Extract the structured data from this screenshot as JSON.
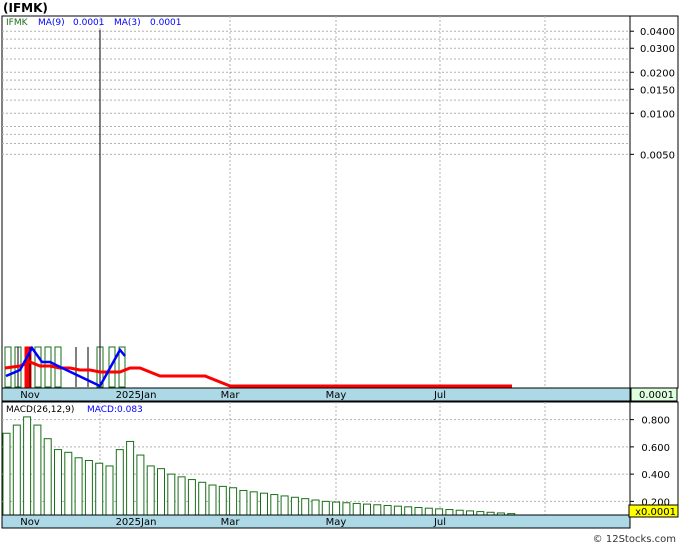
{
  "title": "(IFMK)",
  "footer": "© 12Stocks.com",
  "colors": {
    "frame": "#000000",
    "axis_band": "#add8e6",
    "grid": "#b0b0b0",
    "price_bar": "#1a6e1a",
    "ma9": "#ff0000",
    "ma3": "#0000ff",
    "macd_bar": "#1a6e1a",
    "last_value_bg": "#ddffdd",
    "macd_value_bg": "#ffff00",
    "legend_symbol": "#1a6e1a",
    "legend_ma": "#0000ff"
  },
  "chart_data": [
    {
      "type": "bar",
      "name": "price",
      "legend": {
        "symbol": "IFMK",
        "ma9_label": "MA(9)",
        "ma9_value": "0.0001",
        "ma3_label": "MA(3)",
        "ma3_value": "0.0001"
      },
      "x_ticks": [
        "Nov",
        "2025Jan",
        "Mar",
        "May",
        "Jul"
      ],
      "y_scale": "log",
      "y_ticks": [
        "0.0400",
        "0.0300",
        "0.0200",
        "0.0150",
        "0.0100",
        "0.0050"
      ],
      "last_value": "0.0001",
      "highlighted_bar_index": 2,
      "spike_bar_index": 6,
      "bars": [
        1,
        1,
        1,
        1,
        1,
        1,
        1,
        1,
        1,
        1,
        1,
        1
      ],
      "ma9": [
        0.75,
        0.75,
        0.75,
        0.6,
        0.6,
        0.6,
        0.6,
        0.6,
        1,
        1,
        0.6,
        0.6
      ],
      "ma3": [
        0.6,
        0.6,
        0.75,
        0.75,
        0.75,
        0.6,
        0.4,
        0.6,
        0.8,
        0.9,
        0.7,
        0.5
      ],
      "ma9_flat_from": "Mar",
      "ma9_flat_to": "Jul"
    },
    {
      "type": "bar",
      "name": "macd",
      "legend": {
        "label": "MACD(26,12,9)",
        "value_label": "MACD:0.083"
      },
      "x_ticks": [
        "Nov",
        "2025Jan",
        "Mar",
        "May",
        "Jul"
      ],
      "y_ticks": [
        "0.800",
        "0.600",
        "0.400",
        "0.200"
      ],
      "ylim": [
        0.1,
        0.9
      ],
      "scale_label": "x0.0001",
      "values": [
        0.7,
        0.76,
        0.82,
        0.76,
        0.66,
        0.58,
        0.56,
        0.52,
        0.5,
        0.48,
        0.46,
        0.58,
        0.64,
        0.54,
        0.46,
        0.44,
        0.4,
        0.38,
        0.36,
        0.34,
        0.32,
        0.31,
        0.3,
        0.28,
        0.27,
        0.26,
        0.25,
        0.24,
        0.23,
        0.22,
        0.21,
        0.2,
        0.195,
        0.19,
        0.185,
        0.18,
        0.175,
        0.17,
        0.165,
        0.16,
        0.155,
        0.15,
        0.145,
        0.14,
        0.135,
        0.13,
        0.125,
        0.12,
        0.115,
        0.11
      ]
    }
  ]
}
